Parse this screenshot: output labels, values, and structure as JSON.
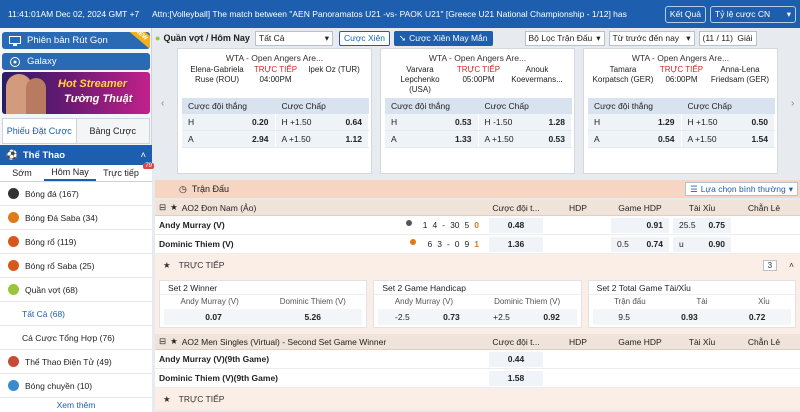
{
  "topbar": {
    "time": "11:41:01AM Dec 02, 2024 GMT +7",
    "announcement": "Attn:[Volleyball] The match between \"AEN Panoramatos U21 -vs- PAOK U21\" [Greece U21 National Championship - 1/12] has",
    "results_label": "Kết Quả",
    "odds_select": "Tỷ lệ cược CN"
  },
  "sidebar": {
    "deposit_label": "Phiên bản Rút Gọn",
    "new_tag": "NEW",
    "galaxy_label": "Galaxy",
    "banner_line1": "Hot Streamer",
    "banner_line2": "Tường Thuật",
    "tabs": [
      "Phiếu Đặt Cược",
      "Bảng Cược"
    ],
    "sport_header": "Thể Thao",
    "sub_tabs": [
      "Sớm",
      "Hôm Nay",
      "Trực tiếp"
    ],
    "live_badge": "79",
    "sports": [
      {
        "label": "Bóng đá",
        "count": "(167)",
        "color": "#333"
      },
      {
        "label": "Bóng Đá Saba",
        "count": "(34)",
        "color": "#e07a17"
      },
      {
        "label": "Bóng rổ",
        "count": "(119)",
        "color": "#d8581c"
      },
      {
        "label": "Bóng rổ Saba",
        "count": "(25)",
        "color": "#d8581c"
      },
      {
        "label": "Quần vợt",
        "count": "(68)",
        "color": "#9ac43a"
      }
    ],
    "tennis_sub": [
      {
        "label": "Tất Cả",
        "count": "(68)"
      },
      {
        "label": "Cá Cược Tổng Hợp",
        "count": "(76)"
      }
    ],
    "sports_after": [
      {
        "label": "Thể Thao Điện Tử",
        "count": "(49)",
        "color": "#c94a38"
      },
      {
        "label": "Bóng chuyền",
        "count": "(10)",
        "color": "#3a8ad0"
      }
    ],
    "more_label": "Xem thêm"
  },
  "filter": {
    "title": "Quần vợt / Hôm Nay",
    "select_all": "Tất Cả",
    "parlay": "Cược Xiên",
    "lucky_parlay": "Cược Xiên May Mắn",
    "league_filter": "Bộ Lọc Trận Đấu",
    "sort": "Từ trước đến nay",
    "page": "(11 / 11)",
    "refresh": "Giải"
  },
  "featured": [
    {
      "league": "WTA - Open Angers Are...",
      "home": "Elena-Gabriela Ruse (ROU)",
      "away": "Ipek Oz (TUR)",
      "status": "TRỰC TIẾP",
      "time": "04:00PM",
      "h1": "Cược đội thắng",
      "h2": "Cược Chấp",
      "r1": {
        "l": "H",
        "v": "0.20",
        "hl": "H +1.50",
        "hv": "0.64"
      },
      "r2": {
        "l": "A",
        "v": "2.94",
        "hl": "A +1.50",
        "hv": "1.12"
      }
    },
    {
      "league": "WTA - Open Angers Are...",
      "home": "Varvara Lepchenko (USA)",
      "away": "Anouk Koevermans...",
      "status": "TRỰC TIẾP",
      "time": "05:00PM",
      "h1": "Cược đội thắng",
      "h2": "Cược Chấp",
      "r1": {
        "l": "H",
        "v": "0.53",
        "hl": "H -1.50",
        "hv": "1.28"
      },
      "r2": {
        "l": "A",
        "v": "1.33",
        "hl": "A +1.50",
        "hv": "0.53"
      }
    },
    {
      "league": "WTA - Open Angers Are...",
      "home": "Tamara Korpatsch (GER)",
      "away": "Anna-Lena Friedsam (GER)",
      "status": "TRỰC TIẾP",
      "time": "06:00PM",
      "h1": "Cược đội thắng",
      "h2": "Cược Chấp",
      "r1": {
        "l": "H",
        "v": "1.29",
        "hl": "H +1.50",
        "hv": "0.50"
      },
      "r2": {
        "l": "A",
        "v": "0.54",
        "hl": "A +1.50",
        "hv": "1.54"
      }
    }
  ],
  "section": {
    "title": "Trận Đấu",
    "view": "Lựa chọn bình thường"
  },
  "table": {
    "league1": "AO2 Đơn Nam (Ảo)",
    "cols": [
      "Cược đội t...",
      "HDP",
      "Game HDP",
      "Tài Xỉu",
      "Chẵn Lẻ"
    ],
    "match1": {
      "home": "Andy Murray (V)",
      "away": "Dominic Thiem (V)",
      "home_score": [
        "1",
        "4",
        "-",
        "30",
        "5",
        "0"
      ],
      "away_score": [
        "6",
        "3",
        "-",
        "0",
        "9",
        "1"
      ],
      "home_ml": "0.48",
      "away_ml": "1.36",
      "home_ghdp": "0.91",
      "away_ghdp_line": "0.5",
      "away_ghdp": "0.74",
      "home_ou_line": "25.5",
      "home_ou": "0.75",
      "away_ou_line": "u",
      "away_ou": "0.90"
    },
    "live_label": "TRỰC TIẾP",
    "live_count": "3",
    "subcards": [
      {
        "title": "Set 2 Winner",
        "lab1": "Andy Murray (V)",
        "lab2": "Dominic Thiem (V)",
        "v1": "0.07",
        "v2": "5.26"
      },
      {
        "title": "Set 2 Game Handicap",
        "lab1": "Andy Murray (V)",
        "lab2": "Dominic Thiem (V)",
        "l1": "-2.5",
        "v1": "0.73",
        "l2": "+2.5",
        "v2": "0.92"
      },
      {
        "title": "Set 2 Total Game Tài/Xỉu",
        "lab0": "Trận đấu",
        "lab1": "Tài",
        "lab2": "Xỉu",
        "l0": "9.5",
        "v1": "0.93",
        "v2": "0.72"
      }
    ],
    "league2": "AO2 Men Singles (Virtual) - Second Set Game Winner",
    "match2": {
      "home": "Andy Murray (V)(9th Game)",
      "away": "Dominic Thiem (V)(9th Game)",
      "home_v": "0.44",
      "away_v": "1.58"
    },
    "live_label2": "TRỰC TIẾP"
  }
}
